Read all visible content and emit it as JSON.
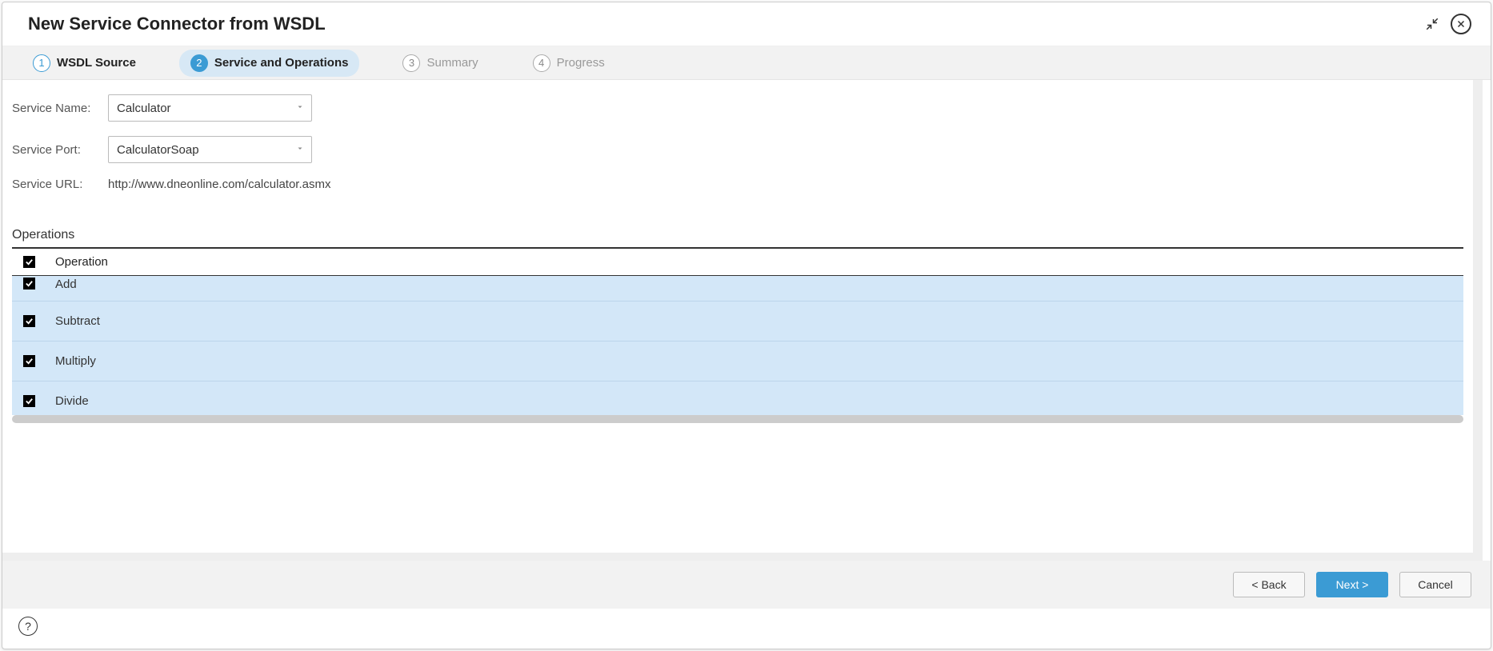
{
  "title": "New Service Connector from WSDL",
  "steps": [
    {
      "num": "1",
      "label": "WSDL Source",
      "state": "completed"
    },
    {
      "num": "2",
      "label": "Service and Operations",
      "state": "active"
    },
    {
      "num": "3",
      "label": "Summary",
      "state": "pending"
    },
    {
      "num": "4",
      "label": "Progress",
      "state": "pending"
    }
  ],
  "form": {
    "serviceName": {
      "label": "Service Name:",
      "value": "Calculator"
    },
    "servicePort": {
      "label": "Service Port:",
      "value": "CalculatorSoap"
    },
    "serviceURL": {
      "label": "Service URL:",
      "value": "http://www.dneonline.com/calculator.asmx"
    }
  },
  "operations": {
    "heading": "Operations",
    "columnHeader": "Operation",
    "rows": [
      {
        "name": "Add",
        "checked": true
      },
      {
        "name": "Subtract",
        "checked": true
      },
      {
        "name": "Multiply",
        "checked": true
      },
      {
        "name": "Divide",
        "checked": true
      }
    ],
    "selectAll": true
  },
  "buttons": {
    "back": "< Back",
    "next": "Next >",
    "cancel": "Cancel"
  }
}
